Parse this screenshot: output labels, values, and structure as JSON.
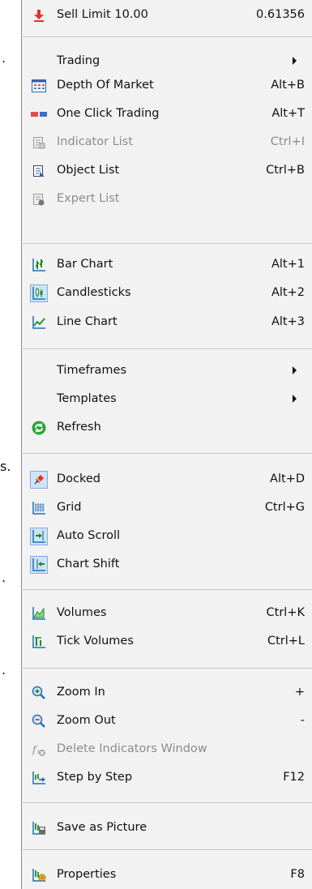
{
  "menu": {
    "items": [
      {
        "label": "Sell Limit 10.00",
        "shortcut": "0.61356",
        "icon": "sell-arrow-icon"
      },
      {
        "label": "Trading",
        "submenu": true
      },
      {
        "label": "Depth Of Market",
        "shortcut": "Alt+B",
        "icon": "depth-of-market-icon"
      },
      {
        "label": "One Click Trading",
        "shortcut": "Alt+T",
        "icon": "one-click-trading-icon"
      },
      {
        "label": "Indicator List",
        "shortcut": "Ctrl+I",
        "icon": "indicator-list-icon",
        "disabled": true
      },
      {
        "label": "Object List",
        "shortcut": "Ctrl+B",
        "icon": "object-list-icon"
      },
      {
        "label": "Expert List",
        "icon": "expert-list-icon",
        "disabled": true
      },
      {
        "label": "Bar Chart",
        "shortcut": "Alt+1",
        "icon": "bar-chart-icon"
      },
      {
        "label": "Candlesticks",
        "shortcut": "Alt+2",
        "icon": "candlesticks-icon",
        "checked": true
      },
      {
        "label": "Line Chart",
        "shortcut": "Alt+3",
        "icon": "line-chart-icon"
      },
      {
        "label": "Timeframes",
        "submenu": true
      },
      {
        "label": "Templates",
        "submenu": true
      },
      {
        "label": "Refresh",
        "icon": "refresh-icon"
      },
      {
        "label": "Docked",
        "shortcut": "Alt+D",
        "icon": "pin-icon",
        "checked": true
      },
      {
        "label": "Grid",
        "shortcut": "Ctrl+G",
        "icon": "grid-icon"
      },
      {
        "label": "Auto Scroll",
        "icon": "auto-scroll-icon",
        "checked": true
      },
      {
        "label": "Chart Shift",
        "icon": "chart-shift-icon",
        "checked": true
      },
      {
        "label": "Volumes",
        "shortcut": "Ctrl+K",
        "icon": "volumes-icon"
      },
      {
        "label": "Tick Volumes",
        "shortcut": "Ctrl+L",
        "icon": "tick-volumes-icon"
      },
      {
        "label": "Zoom In",
        "shortcut": "+",
        "icon": "zoom-in-icon"
      },
      {
        "label": "Zoom Out",
        "shortcut": "-",
        "icon": "zoom-out-icon"
      },
      {
        "label": "Delete Indicators Window",
        "icon": "delete-indicators-icon",
        "disabled": true
      },
      {
        "label": "Step by Step",
        "shortcut": "F12",
        "icon": "step-by-step-icon"
      },
      {
        "label": "Save as Picture",
        "icon": "save-picture-icon"
      },
      {
        "label": "Properties",
        "shortcut": "F8",
        "icon": "properties-icon"
      }
    ]
  },
  "left_fragments": [
    ".",
    "s.",
    ".",
    "."
  ],
  "colors": {
    "menu_bg": "#f2f2f2",
    "check_bg": "#cfe3f5",
    "disabled_text": "#8c8c8c",
    "sell_red": "#e2341d",
    "refresh_green": "#2aa63a",
    "chart_blue": "#1f6fb8"
  }
}
